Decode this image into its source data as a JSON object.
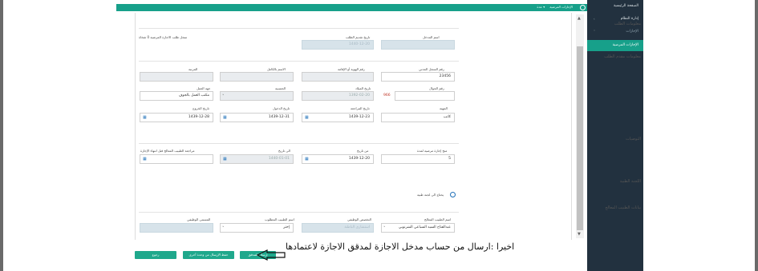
{
  "topbar": {
    "menu_items": [
      "الإجازات المرضية",
      "▾ عدة"
    ],
    "icon": "compass-icon"
  },
  "sidebar": {
    "items": [
      "الصفحة الرئيسية",
      "إدارة النظام",
      "الإجازات",
      "الإجازات المرضية"
    ],
    "active": "الإجازات المرضية"
  },
  "sections": {
    "request": "معلومات الطلب",
    "applicant": "معلومات مقدم الطلب",
    "recommendations": "التوصيات",
    "medical_committee": "اللجنة الطبية",
    "doctor": "بيانات الطبيب المعالج"
  },
  "request_info": {
    "entry_label": "اسم المدخل",
    "entry_value": "",
    "request_date_label": "تاريخ تقديم الطلب",
    "request_date_value": "1440-12-20",
    "record_label": "سجل طلب الاجازة المرضية 0 شخاة"
  },
  "applicant": {
    "civil_id_label": "رقم السجل المدني",
    "civil_id_value": "23456",
    "mobile_label": "رقم الجوال",
    "mobile_prefix": "966",
    "mobile_value": "",
    "identity_label": "رقم الهوية أو الإقامة",
    "identity_value": "",
    "fullname_label": "الاسم بالكامل",
    "fullname_value": "",
    "birthdate_label": "تاريخ الميلاد",
    "birthdate_value": "1392-02-20",
    "nationality_label": "الجنسية",
    "nationality_value": "",
    "work_label": "جهة العمل",
    "work_value": "مكتب العمل بالجوف",
    "rank_label": "المرتبة",
    "rank_value": "",
    "job_label": "المهنة",
    "job_value": "كاتب",
    "study_date_label": "تاريخ المراجعة",
    "study_date_value": "1439-12-23",
    "entry_date_label": "تاريخ الدخول",
    "entry_date_value": "1439-12-31",
    "exit_date_label": "تاريخ الخروج",
    "exit_date_value": "1439-12-28",
    "reference_label": "الرقم"
  },
  "recommendations": {
    "days_label": "منح إجازة مرضية لمدة",
    "days_value": "5",
    "from_label": "من تاريخ",
    "from_value": "1439-12-20",
    "to_label": "الى تاريخ",
    "to_value": "1440-01-01",
    "followup_label": "مراجعة الطبيب المعالج قبل انتهاء الإجازة"
  },
  "committee": {
    "checkbox_label": "يحتاج الى لجنة طبية"
  },
  "doctor": {
    "name_label": "اسم الطبيب المعالج",
    "name_value": "عبدالفتاح السيد السباعي الشرنوبي",
    "specialty_label": "التخصص الوظيفي",
    "specialty_value": "استشاري الباطنة",
    "role_label": "اسم الطبيب المطلوب",
    "role_value": "",
    "title_label": "المسمى الوظيفي",
    "title_value": "",
    "select_value": "إختر"
  },
  "buttons": {
    "send_to_auditor": "إرسال للمدقق",
    "send_alt": "حفظ الإرسال من وحدة أخرى",
    "back": "رجوع"
  },
  "annotation": "اخيرا :ارسال من حساب مدخل الاجازة  لمدقق الاجازة لاعتمادها"
}
